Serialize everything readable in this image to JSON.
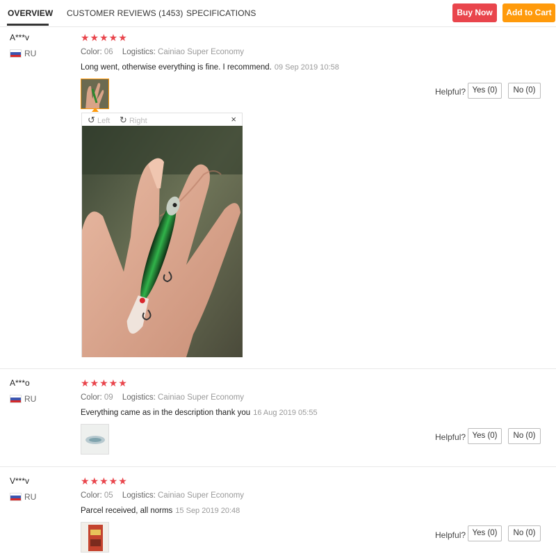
{
  "tabs": [
    {
      "label": "OVERVIEW",
      "active": true
    },
    {
      "label": "CUSTOMER REVIEWS (1453)",
      "active": false
    },
    {
      "label": "SPECIFICATIONS",
      "active": false
    }
  ],
  "actions": {
    "buy_now": "Buy Now",
    "add_to_cart": "Add to Cart"
  },
  "colors": {
    "buy": "#e9454c",
    "cart": "#ff9a0b",
    "stars": "#e9454c"
  },
  "labels": {
    "color": "Color:",
    "logistics": "Logistics:",
    "helpful": "Helpful?"
  },
  "reviews": [
    {
      "user": "A***v",
      "country": "RU",
      "stars": "★★★★★",
      "rating": 5,
      "color": "06",
      "logistics": "Cainiao Super Economy",
      "text": "Long went, otherwise everything is fine. I recommend.",
      "date": "09 Sep 2019 10:58",
      "yes": "Yes (0)",
      "no": "No (0)"
    },
    {
      "user": "A***o",
      "country": "RU",
      "stars": "★★★★★",
      "rating": 5,
      "color": "09",
      "logistics": "Cainiao Super Economy",
      "text": "Everything came as in the description thank you",
      "date": "16 Aug 2019 05:55",
      "yes": "Yes (0)",
      "no": "No (0)"
    },
    {
      "user": "V***v",
      "country": "RU",
      "stars": "★★★★★",
      "rating": 5,
      "color": "05",
      "logistics": "Cainiao Super Economy",
      "text": "Parcel received, all norms",
      "date": "15 Sep 2019 20:48",
      "yes": "Yes (0)",
      "no": "No (0)"
    }
  ],
  "viewer": {
    "rotate_left": "Left",
    "rotate_right": "Right",
    "close": "×",
    "rotate_left_icon": "↺",
    "rotate_right_icon": "↻"
  }
}
